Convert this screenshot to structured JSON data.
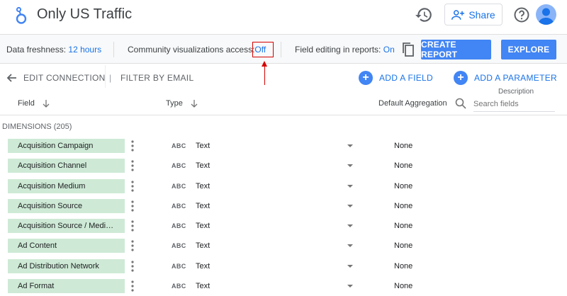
{
  "app": {
    "title": "Only US Traffic",
    "share_label": "Share"
  },
  "settings_bar": {
    "freshness_label": "Data freshness:",
    "freshness_value": "12 hours",
    "community_label": "Community visualizations access:",
    "community_value": "Off",
    "field_editing_label": "Field editing in reports:",
    "field_editing_value": "On",
    "create_report_label": "CREATE REPORT",
    "explore_label": "EXPLORE"
  },
  "toolbar": {
    "edit_connection_label": "EDIT CONNECTION",
    "filter_label": "FILTER BY EMAIL",
    "add_field_label": "ADD A FIELD",
    "add_parameter_label": "ADD A PARAMETER",
    "description_label": "Description"
  },
  "columns": {
    "field": "Field",
    "type": "Type",
    "default_aggregation": "Default Aggregation",
    "search_placeholder": "Search fields"
  },
  "dimensions_label": "DIMENSIONS (205)",
  "rows": [
    {
      "field": "Acquisition Campaign",
      "type_icon": "ABC",
      "type": "Text",
      "aggregation": "None"
    },
    {
      "field": "Acquisition Channel",
      "type_icon": "ABC",
      "type": "Text",
      "aggregation": "None"
    },
    {
      "field": "Acquisition Medium",
      "type_icon": "ABC",
      "type": "Text",
      "aggregation": "None"
    },
    {
      "field": "Acquisition Source",
      "type_icon": "ABC",
      "type": "Text",
      "aggregation": "None"
    },
    {
      "field": "Acquisition Source / Medi…",
      "type_icon": "ABC",
      "type": "Text",
      "aggregation": "None"
    },
    {
      "field": "Ad Content",
      "type_icon": "ABC",
      "type": "Text",
      "aggregation": "None"
    },
    {
      "field": "Ad Distribution Network",
      "type_icon": "ABC",
      "type": "Text",
      "aggregation": "None"
    },
    {
      "field": "Ad Format",
      "type_icon": "ABC",
      "type": "Text",
      "aggregation": "None"
    }
  ],
  "colors": {
    "accent": "#1a73e8",
    "button_blue": "#4285f4",
    "dimension_chip": "#ceead6",
    "annotation_red": "#d50000"
  }
}
